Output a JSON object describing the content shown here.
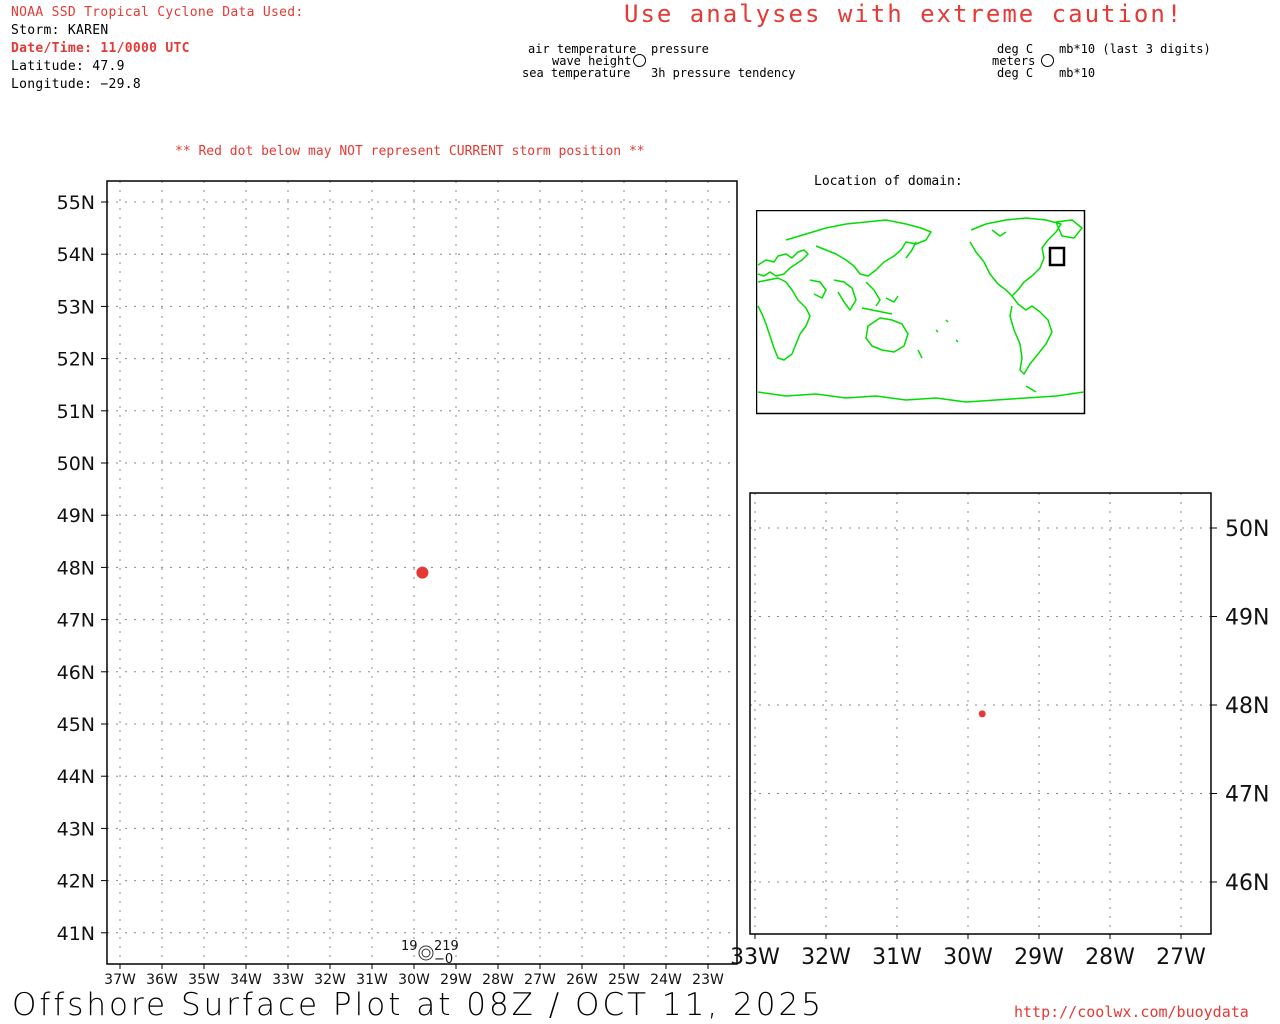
{
  "header": {
    "source": "NOAA SSD Tropical Cyclone Data Used:",
    "storm": "Storm: KAREN",
    "datetime": "Date/Time: 11/0000 UTC",
    "latitude": "Latitude: 47.9",
    "longitude": "Longitude: −29.8",
    "warning": "Use analyses with extreme caution!"
  },
  "legend": {
    "left_top": "air temperature",
    "left_mid": "wave height",
    "left_bot": "sea temperature",
    "right_top": "pressure",
    "right_bot": "3h pressure tendency",
    "units_left_top": "deg C",
    "units_left_mid": "meters",
    "units_left_bot": "deg C",
    "units_right_top": "mb*10 (last 3 digits)",
    "units_right_bot": "mb*10"
  },
  "notes": {
    "red_dot": "** Red dot below may NOT represent CURRENT storm position **",
    "location_of_domain": "Location of domain:"
  },
  "main_map": {
    "lat_labels": [
      "55N",
      "54N",
      "53N",
      "52N",
      "51N",
      "50N",
      "49N",
      "48N",
      "47N",
      "46N",
      "45N",
      "44N",
      "43N",
      "42N",
      "41N"
    ],
    "lon_labels": [
      "37W",
      "36W",
      "35W",
      "34W",
      "33W",
      "32W",
      "31W",
      "30W",
      "29W",
      "28W",
      "27W",
      "26W",
      "25W",
      "24W",
      "23W"
    ],
    "storm_lat": 47.9,
    "storm_lon": -29.8,
    "station": {
      "air_temp": "19",
      "pressure": "219",
      "tendency": "−0"
    }
  },
  "zoom_map": {
    "lat_labels": [
      "50N",
      "49N",
      "48N",
      "47N",
      "46N"
    ],
    "lon_labels": [
      "33W",
      "32W",
      "31W",
      "30W",
      "29W",
      "28W",
      "27W"
    ]
  },
  "footer": {
    "title": "Offshore Surface Plot at 08Z / OCT 11, 2025",
    "url": "http://coolwx.com/buoydata"
  },
  "colors": {
    "accent": "#e53935",
    "coast": "#00dd00",
    "grid": "#888888"
  }
}
